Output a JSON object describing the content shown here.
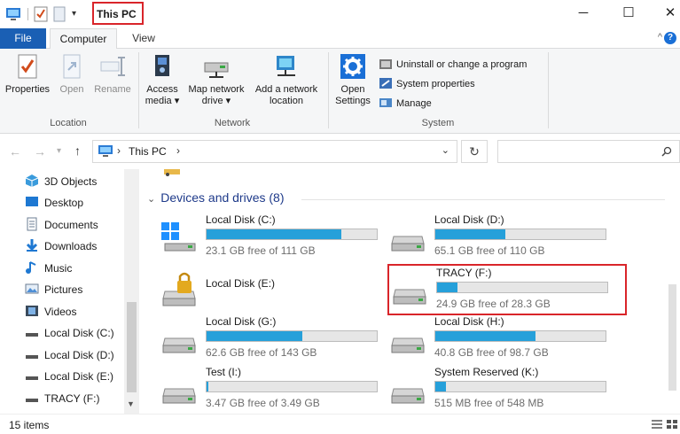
{
  "window": {
    "title": "This PC"
  },
  "tabs": [
    {
      "label": "File"
    },
    {
      "label": "Computer"
    },
    {
      "label": "View"
    }
  ],
  "ribbon": {
    "location": {
      "label": "Location",
      "buttons": [
        {
          "label": "Properties",
          "icon": "properties-icon"
        },
        {
          "label": "Open",
          "icon": "open-icon"
        },
        {
          "label": "Rename",
          "icon": "rename-icon"
        }
      ]
    },
    "network": {
      "label": "Network",
      "access_media": {
        "line1": "Access",
        "line2": "media ▾"
      },
      "map_drive": {
        "line1": "Map network",
        "line2": "drive ▾"
      },
      "add_location": {
        "line1": "Add a network",
        "line2": "location"
      }
    },
    "system": {
      "label": "System",
      "open_settings": {
        "line1": "Open",
        "line2": "Settings"
      },
      "uninstall": "Uninstall or change a program",
      "system_properties": "System properties",
      "manage": "Manage"
    }
  },
  "address": {
    "path": "This PC"
  },
  "sidebar": {
    "items": [
      {
        "label": "3D Objects",
        "icon": "3d-objects-icon"
      },
      {
        "label": "Desktop",
        "icon": "desktop-icon"
      },
      {
        "label": "Documents",
        "icon": "documents-icon"
      },
      {
        "label": "Downloads",
        "icon": "downloads-icon"
      },
      {
        "label": "Music",
        "icon": "music-icon"
      },
      {
        "label": "Pictures",
        "icon": "pictures-icon"
      },
      {
        "label": "Videos",
        "icon": "videos-icon"
      },
      {
        "label": "Local Disk (C:)",
        "icon": "drive-icon"
      },
      {
        "label": "Local Disk (D:)",
        "icon": "drive-icon"
      },
      {
        "label": "Local Disk (E:)",
        "icon": "drive-icon"
      },
      {
        "label": "TRACY (F:)",
        "icon": "drive-icon"
      }
    ]
  },
  "content": {
    "section_title": "Devices and drives (8)",
    "drives": [
      {
        "name": "Local Disk (C:)",
        "free": "23.1 GB free of 111 GB",
        "used_fraction": 0.79,
        "icon": "windows-drive-icon"
      },
      {
        "name": "Local Disk (D:)",
        "free": "65.1 GB free of 110 GB",
        "used_fraction": 0.41,
        "icon": "drive-icon"
      },
      {
        "name": "Local Disk (E:)",
        "icon": "locked-drive-icon"
      },
      {
        "name": "TRACY (F:)",
        "free": "24.9 GB free of 28.3 GB",
        "used_fraction": 0.12,
        "icon": "drive-icon"
      },
      {
        "name": "Local Disk (G:)",
        "free": "62.6 GB free of 143 GB",
        "used_fraction": 0.56,
        "icon": "drive-icon"
      },
      {
        "name": "Local Disk (H:)",
        "free": "40.8 GB free of 98.7 GB",
        "used_fraction": 0.59,
        "icon": "drive-icon"
      },
      {
        "name": "Test (I:)",
        "free": "3.47 GB free of 3.49 GB",
        "used_fraction": 0.01,
        "icon": "drive-icon"
      },
      {
        "name": "System Reserved (K:)",
        "free": "515 MB free of 548 MB",
        "used_fraction": 0.06,
        "icon": "drive-icon"
      }
    ]
  },
  "status": {
    "items_count": "15 items"
  },
  "colors": {
    "accent": "#1a5fb4",
    "bar_fill": "#26a0da",
    "highlight": "#d9252a"
  }
}
